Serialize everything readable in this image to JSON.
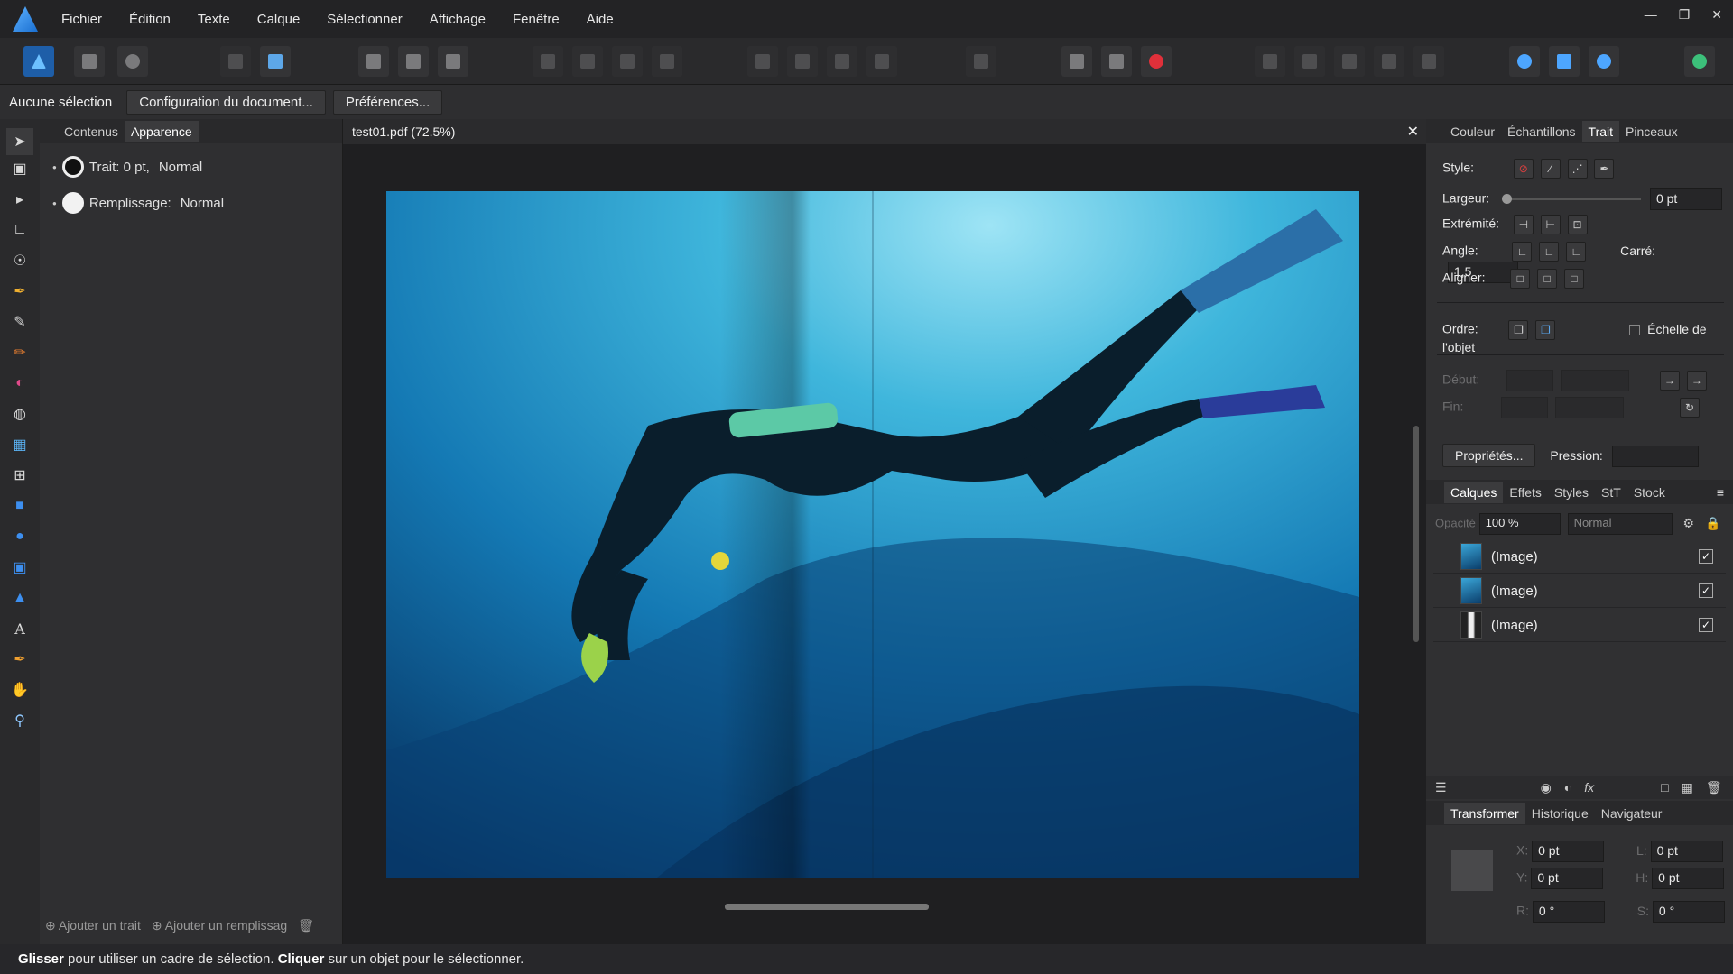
{
  "menu": [
    "Fichier",
    "Édition",
    "Texte",
    "Calque",
    "Sélectionner",
    "Affichage",
    "Fenêtre",
    "Aide"
  ],
  "context": {
    "selection": "Aucune sélection",
    "doc_setup": "Configuration du document...",
    "preferences": "Préférences..."
  },
  "left_panel": {
    "tabs": [
      "Contenus",
      "Apparence"
    ],
    "stroke_label": "Trait: 0 pt,",
    "stroke_mode": "Normal",
    "fill_label": "Remplissage:",
    "fill_mode": "Normal",
    "add_stroke": "Ajouter un trait",
    "add_fill": "Ajouter un remplissag"
  },
  "document": {
    "tab_title": "test01.pdf (72.5%)"
  },
  "stroke_panel": {
    "tabs": [
      "Couleur",
      "Échantillons",
      "Trait",
      "Pinceaux"
    ],
    "style_label": "Style:",
    "width_label": "Largeur:",
    "width_value": "0 pt",
    "cap_label": "Extrémité:",
    "join_label": "Angle:",
    "miter_label": "Carré:",
    "miter_value": "1,5",
    "align_label": "Aligner:",
    "order_label": "Ordre:",
    "scale_label": "Échelle de l'objet",
    "start_label": "Début:",
    "end_label": "Fin:",
    "properties_btn": "Propriétés...",
    "pressure_label": "Pression:"
  },
  "layers_panel": {
    "tabs": [
      "Calques",
      "Effets",
      "Styles",
      "StT",
      "Stock"
    ],
    "opacity_label": "Opacité",
    "opacity_value": "100 %",
    "blend_mode": "Normal",
    "layers": [
      "(Image)",
      "(Image)",
      "(Image)"
    ]
  },
  "transform_panel": {
    "tabs": [
      "Transformer",
      "Historique",
      "Navigateur"
    ],
    "x_label": "X:",
    "x_value": "0 pt",
    "y_label": "Y:",
    "y_value": "0 pt",
    "w_label": "L:",
    "w_value": "0 pt",
    "h_label": "H:",
    "h_value": "0 pt",
    "r_label": "R:",
    "r_value": "0 °",
    "s_label": "S:",
    "s_value": "0 °"
  },
  "status": {
    "drag": "Glisser",
    "drag_text": " pour utiliser un cadre de sélection. ",
    "click": "Cliquer",
    "click_text": " sur un objet pour le sélectionner."
  }
}
